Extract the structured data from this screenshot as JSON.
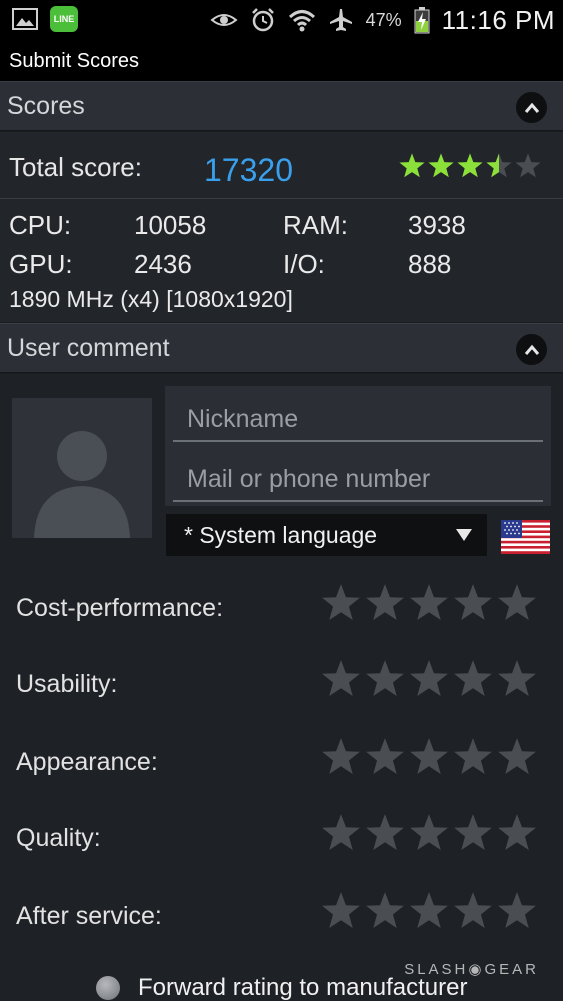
{
  "status_bar": {
    "left_icons": [
      "gallery-icon",
      "line-app-icon"
    ],
    "line_icon_text": "LINE",
    "right_icons": [
      "eye-icon",
      "alarm-icon",
      "wifi-icon",
      "airplane-icon"
    ],
    "battery_percent": "47%",
    "time": "11:16 PM"
  },
  "action_bar": {
    "title": "Submit Scores"
  },
  "scores": {
    "header": "Scores",
    "total_label": "Total score:",
    "total_value": "17320",
    "total_rating": 3.5,
    "star_color_active": "#8ce03a",
    "cpu_label": "CPU:",
    "cpu_value": "10058",
    "ram_label": "RAM:",
    "ram_value": "3938",
    "gpu_label": "GPU:",
    "gpu_value": "2436",
    "io_label": "I/O:",
    "io_value": "888",
    "spec_line": "1890 MHz (x4) [1080x1920]"
  },
  "user_comment": {
    "header": "User comment",
    "nickname_placeholder": "Nickname",
    "mail_placeholder": "Mail or phone number",
    "language_selected": "* System language",
    "flag_icon": "us-flag-icon",
    "ratings": [
      {
        "label": "Cost-performance:",
        "stars": 0
      },
      {
        "label": "Usability:",
        "stars": 0
      },
      {
        "label": "Appearance:",
        "stars": 0
      },
      {
        "label": "Quality:",
        "stars": 0
      },
      {
        "label": "After service:",
        "stars": 0
      }
    ],
    "forward_label": "Forward rating to manufacturer"
  },
  "watermark": "SLASH◉GEAR"
}
